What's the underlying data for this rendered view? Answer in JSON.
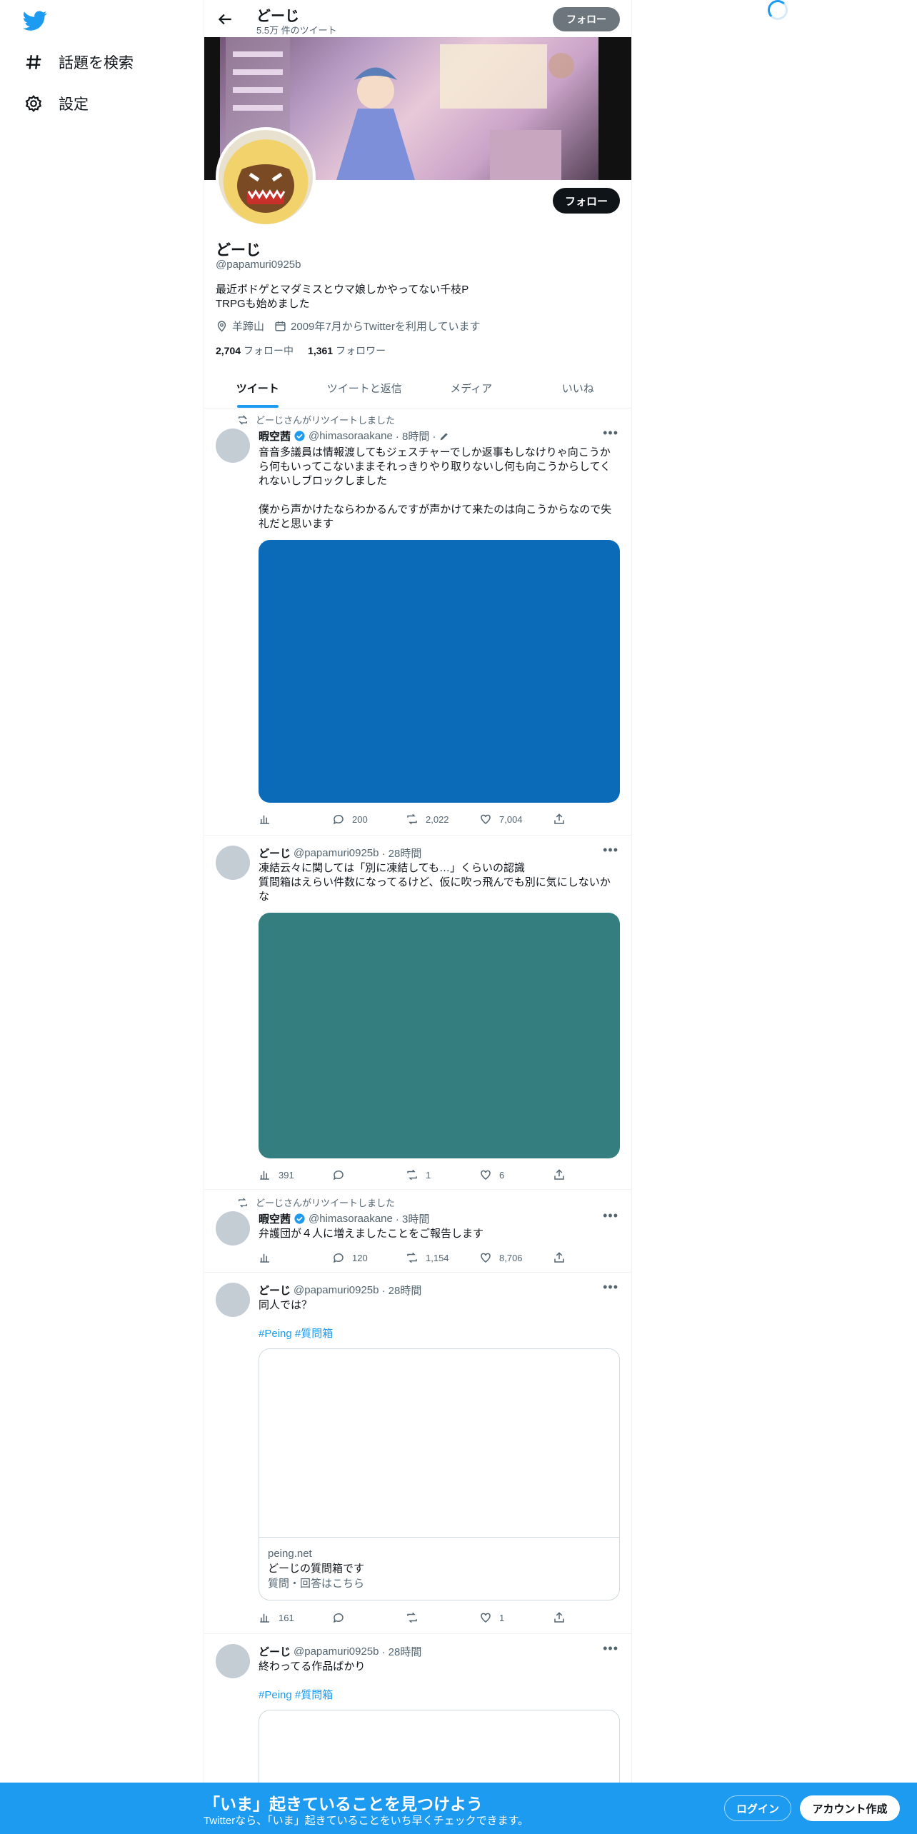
{
  "nav": {
    "explore_label": "話題を検索",
    "settings_label": "設定"
  },
  "header": {
    "name": "どーじ",
    "tweet_count": "5.5万 件のツイート",
    "follow_label": "フォロー"
  },
  "profile": {
    "follow_label": "フォロー",
    "name": "どーじ",
    "handle": "@papamuri0925b",
    "bio": "最近ボドゲとマダミスとウマ娘しかやってない千枝P\nTRPGも始めました",
    "location": "羊蹄山",
    "joined": "2009年7月からTwitterを利用しています",
    "following_count": "2,704",
    "following_label": "フォロー中",
    "followers_count": "1,361",
    "followers_label": "フォロワー"
  },
  "tabs": [
    "ツイート",
    "ツイートと返信",
    "メディア",
    "いいね"
  ],
  "tweets": [
    {
      "retweet_label": "どーじさんがリツイートしました",
      "name": "暇空茜",
      "handle": "@himasoraakane",
      "time": "· 8時間 ·",
      "text": "音音多議員は情報渡してもジェスチャーでしか返事もしなけりゃ向こうから何もいってこないままそれっきりやり取りないし何も向こうからしてくれないしブロックしました\n\n僕から声かけたならわかるんですが声かけて来たのは向こうからなので失礼だと思います",
      "media_color": "#0b6bb8",
      "views": "",
      "replies": "200",
      "retweets": "2,022",
      "likes": "7,004"
    },
    {
      "name": "どーじ",
      "handle": "@papamuri0925b",
      "time": "· 28時間",
      "text": "凍結云々に関しては「別に凍結しても…」くらいの認識\n質問箱はえらい件数になってるけど、仮に吹っ飛んでも別に気にしないかな",
      "media_color": "#347e7f",
      "views": "391",
      "replies": "",
      "retweets": "1",
      "likes": "6"
    },
    {
      "retweet_label": "どーじさんがリツイートしました",
      "name": "暇空茜",
      "handle": "@himasoraakane",
      "time": "· 3時間",
      "text": "弁護団が４人に増えましたことをご報告します",
      "views": "",
      "replies": "120",
      "retweets": "1,154",
      "likes": "8,706"
    },
    {
      "name": "どーじ",
      "handle": "@papamuri0925b",
      "time": "· 28時間",
      "text": "同人では？",
      "tags": "#Peing #質問箱",
      "card_domain": "peing.net",
      "card_title": "どーじの質問箱です",
      "card_desc": "質問・回答はこちら",
      "views": "161",
      "replies": "",
      "retweets": "",
      "likes": "1"
    },
    {
      "name": "どーじ",
      "handle": "@papamuri0925b",
      "time": "· 28時間",
      "text": "終わってる作品ばかり",
      "tags": "#Peing #質問箱"
    }
  ],
  "bottom": {
    "title": "「いま」起きていることを見つけよう",
    "subtitle": "Twitterなら、「いま」起きていることをいち早くチェックできます。",
    "login_label": "ログイン",
    "signup_label": "アカウント作成"
  },
  "colors": {
    "accent": "#1d9bf0",
    "text": "#0f1419",
    "muted": "#536471"
  }
}
